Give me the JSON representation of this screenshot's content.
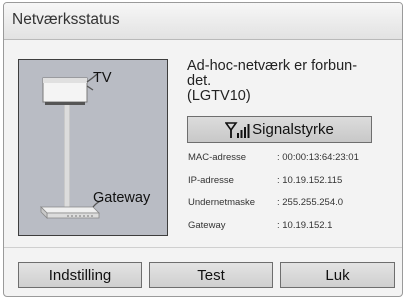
{
  "window": {
    "title": "Netværksstatus"
  },
  "diagram": {
    "tv_label": "TV",
    "gateway_label": "Gateway",
    "tv_icon": "tv-icon",
    "router_icon": "router-icon"
  },
  "status": {
    "line1": "Ad-hoc-netværk er forbun-",
    "line2": "det.",
    "line3": "(LGTV10)"
  },
  "signal": {
    "label": "Signalstyrke",
    "icon": "signal-strength-icon"
  },
  "info": [
    {
      "key": "MAC-adresse",
      "value": ": 00:00:13:64:23:01"
    },
    {
      "key": "IP-adresse",
      "value": ": 10.19.152.115"
    },
    {
      "key": "Undernetmaske",
      "value": ": 255.255.254.0"
    },
    {
      "key": "Gateway",
      "value": ": 10.19.152.1"
    }
  ],
  "buttons": {
    "setup": "Indstilling",
    "test": "Test",
    "close": "Luk"
  }
}
